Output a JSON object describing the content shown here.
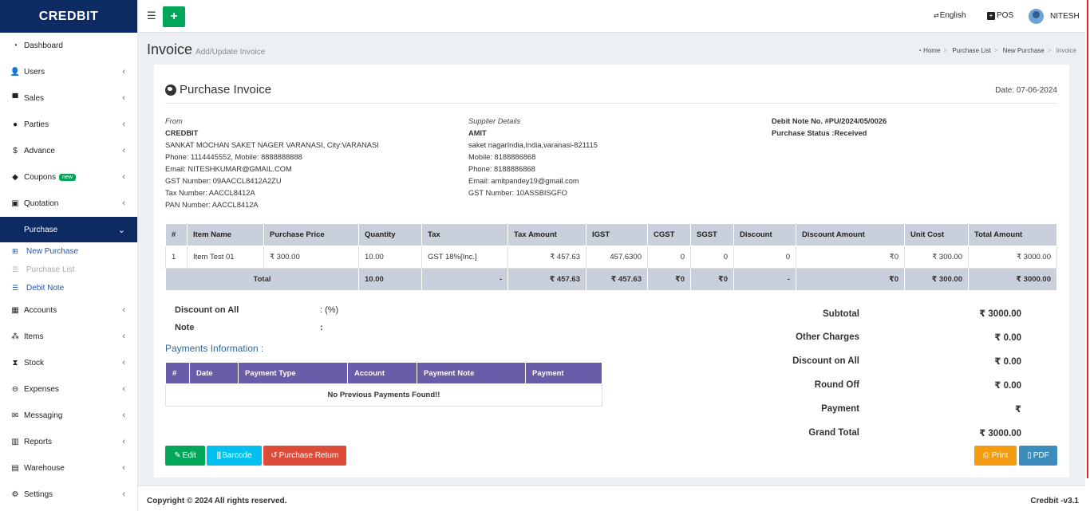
{
  "brand": "CREDBIT",
  "sidebar": {
    "items": [
      {
        "label": "Dashboard",
        "icon": "dashboard-icon"
      },
      {
        "label": "Users",
        "icon": "user-plus-icon"
      },
      {
        "label": "Sales",
        "icon": "cart-icon"
      },
      {
        "label": "Parties",
        "icon": "users-icon"
      },
      {
        "label": "Advance",
        "icon": "dollar-icon"
      },
      {
        "label": "Coupons",
        "icon": "tag-icon",
        "badge": "new"
      },
      {
        "label": "Quotation",
        "icon": "calendar-plus-icon"
      },
      {
        "label": "Purchase",
        "icon": "",
        "active": true
      },
      {
        "label": "Accounts",
        "icon": "grid-icon"
      },
      {
        "label": "Items",
        "icon": "cubes-icon"
      },
      {
        "label": "Stock",
        "icon": "hourglass-icon"
      },
      {
        "label": "Expenses",
        "icon": "minus-circle-icon"
      },
      {
        "label": "Messaging",
        "icon": "envelope-icon"
      },
      {
        "label": "Reports",
        "icon": "bar-chart-icon"
      },
      {
        "label": "Warehouse",
        "icon": "building-icon"
      },
      {
        "label": "Settings",
        "icon": "cogs-icon"
      }
    ],
    "purchase_sub": [
      {
        "label": "New Purchase",
        "icon": "plus-square-icon"
      },
      {
        "label": "Purchase List",
        "icon": "list-icon"
      },
      {
        "label": "Debit Note",
        "icon": "list-icon"
      }
    ]
  },
  "topbar": {
    "language": "English",
    "pos": "POS",
    "user": "NITESH"
  },
  "header": {
    "title": "Invoice",
    "subtitle": "Add/Update Invoice"
  },
  "breadcrumb": [
    "Home",
    "Purchase List",
    "New Purchase",
    "Invoice"
  ],
  "invoice": {
    "title": "Purchase Invoice",
    "date": "Date: 07-06-2024",
    "from": {
      "heading": "From",
      "name": "CREDBIT",
      "lines": [
        "SANKAT MOCHAN SAKET NAGER VARANASI, City:VARANASI",
        "Phone: 1114445552, Mobile: 8888888888",
        "Email: NITESHKUMAR@GMAIL.COM",
        "GST Number: 09AACCL8412A2ZU",
        "Tax Number: AACCL8412A",
        "PAN Number: AACCL8412A"
      ]
    },
    "supplier": {
      "heading": "Supplier Details",
      "name": "AMIT",
      "lines": [
        "saket nagarIndia,India,varanasi-821115",
        "Mobile: 8188886868",
        "Phone: 8188886868",
        "Email: amitpandey19@gmail.com",
        "GST Number: 10ASSBISGFO"
      ]
    },
    "debit_note": "Debit Note No. #PU/2024/05/0026",
    "status": "Purchase Status :Received"
  },
  "items_table": {
    "headers": [
      "#",
      "Item Name",
      "Purchase Price",
      "Quantity",
      "Tax",
      "Tax Amount",
      "IGST",
      "CGST",
      "SGST",
      "Discount",
      "Discount Amount",
      "Unit Cost",
      "Total Amount"
    ],
    "rows": [
      [
        "1",
        "Item Test 01",
        "₹ 300.00",
        "10.00",
        "GST 18%[Inc.]",
        "₹ 457.63",
        "457.6300",
        "0",
        "0",
        "0",
        "₹0",
        "₹ 300.00",
        "₹ 3000.00"
      ]
    ],
    "total": [
      "Total",
      "10.00",
      "-",
      "₹ 457.63",
      "₹ 457.63",
      "₹0",
      "₹0",
      "-",
      "₹0",
      "₹ 300.00",
      "₹ 3000.00"
    ]
  },
  "discount_all": {
    "label": "Discount on All",
    "value": ": (%)"
  },
  "note": {
    "label": "Note",
    "value": ":"
  },
  "payments": {
    "title": "Payments Information :",
    "headers": [
      "#",
      "Date",
      "Payment Type",
      "Account",
      "Payment Note",
      "Payment"
    ],
    "empty": "No Previous Payments Found!!"
  },
  "summary": [
    {
      "label": "Subtotal",
      "value": "₹ 3000.00"
    },
    {
      "label": "Other Charges",
      "value": "₹ 0.00"
    },
    {
      "label": "Discount on All",
      "value": "₹ 0.00"
    },
    {
      "label": "Round Off",
      "value": "₹ 0.00"
    },
    {
      "label": "Payment",
      "value": "₹"
    },
    {
      "label": "Grand Total",
      "value": "₹ 3000.00"
    }
  ],
  "buttons": {
    "edit": "Edit",
    "barcode": "Barcode",
    "purchase_return": "Purchase Return",
    "print": "Print",
    "pdf": "PDF"
  },
  "colors": {
    "brand": "#0e2a63",
    "green": "#00a65a",
    "cyan": "#00c0ef",
    "red": "#dd4b39",
    "orange": "#f39c12",
    "blue": "#3c8dbc",
    "table_header": "#c9cfdb",
    "payment_header": "#6a5ca8"
  },
  "footer": {
    "copyright": "Copyright © 2024 All rights reserved.",
    "version": "Credbit -v3.1"
  }
}
